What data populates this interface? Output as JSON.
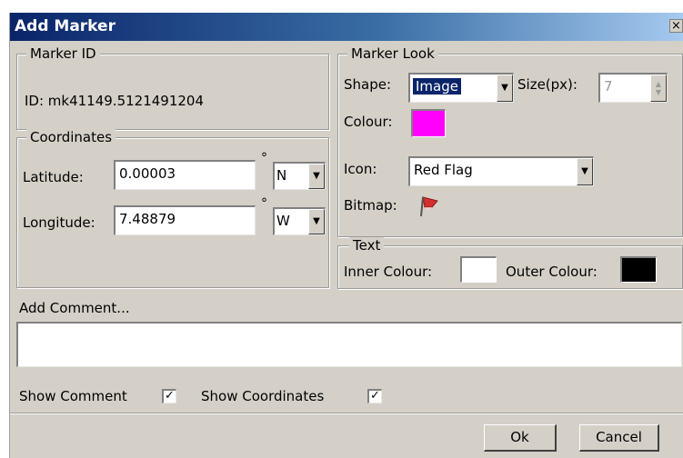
{
  "window": {
    "title": "Add Marker",
    "close_glyph": "×"
  },
  "marker_id": {
    "legend": "Marker ID",
    "text": "ID: mk41149.5121491204"
  },
  "coordinates": {
    "legend": "Coordinates",
    "degree_symbol": "°",
    "latitude": {
      "label": "Latitude:",
      "value": "0.00003",
      "hemisphere": "N"
    },
    "longitude": {
      "label": "Longitude:",
      "value": "7.48879",
      "hemisphere": "W"
    }
  },
  "marker_look": {
    "legend": "Marker Look",
    "shape_label": "Shape:",
    "shape_value": "Image",
    "size_label": "Size(px):",
    "size_value": "7",
    "colour_label": "Colour:",
    "colour_value": "#ff00ff",
    "icon_label": "Icon:",
    "icon_value": "Red Flag",
    "bitmap_label": "Bitmap:",
    "bitmap_icon": "red-flag-icon"
  },
  "text_group": {
    "legend": "Text",
    "inner_label": "Inner Colour:",
    "inner_colour": "#ffffff",
    "outer_label": "Outer Colour:",
    "outer_colour": "#000000"
  },
  "comment": {
    "label": "Add Comment...",
    "value": ""
  },
  "options": {
    "show_comment_label": "Show Comment",
    "show_comment_checked": true,
    "show_coordinates_label": "Show Coordinates",
    "show_coordinates_checked": true
  },
  "buttons": {
    "ok": "Ok",
    "cancel": "Cancel"
  },
  "colors": {
    "title_gradient_start": "#0a246a",
    "dialog_bg": "#d4d0c8",
    "selection": "#0a246a"
  }
}
